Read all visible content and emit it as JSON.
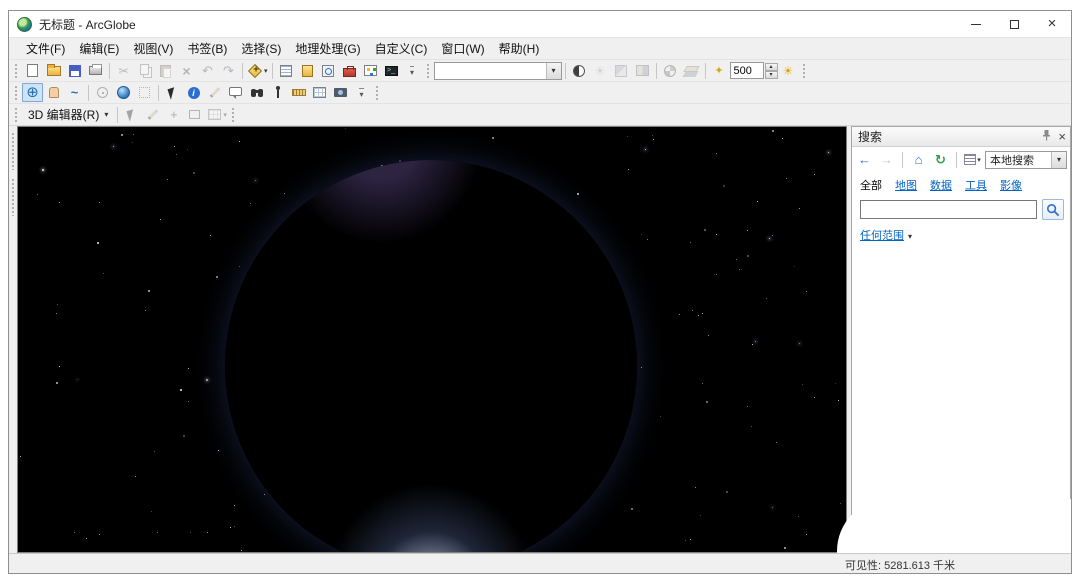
{
  "window": {
    "title": "无标题 - ArcGlobe"
  },
  "menu_bar": {
    "items": [
      "文件(F)",
      "编辑(E)",
      "视图(V)",
      "书签(B)",
      "选择(S)",
      "地理处理(G)",
      "自定义(C)",
      "窗口(W)",
      "帮助(H)"
    ]
  },
  "standard_toolbar": {
    "layer_combo_value": "",
    "distance_spinner_value": "500"
  },
  "editor_toolbar": {
    "label": "3D 编辑器(R)"
  },
  "search_panel": {
    "title": "搜索",
    "search_type_value": "本地搜索",
    "tabs": [
      "全部",
      "地图",
      "数据",
      "工具",
      "影像"
    ],
    "search_input_value": "",
    "scope_label": "任何范围"
  },
  "status_bar": {
    "visibility_text": "可见性: 5281.613 千米"
  },
  "colors": {
    "space_background": "#000000",
    "atmosphere_glow": "#7b8fd4",
    "selected_tool_highlight": "#cfe3f7",
    "link_blue": "#0563c1"
  }
}
